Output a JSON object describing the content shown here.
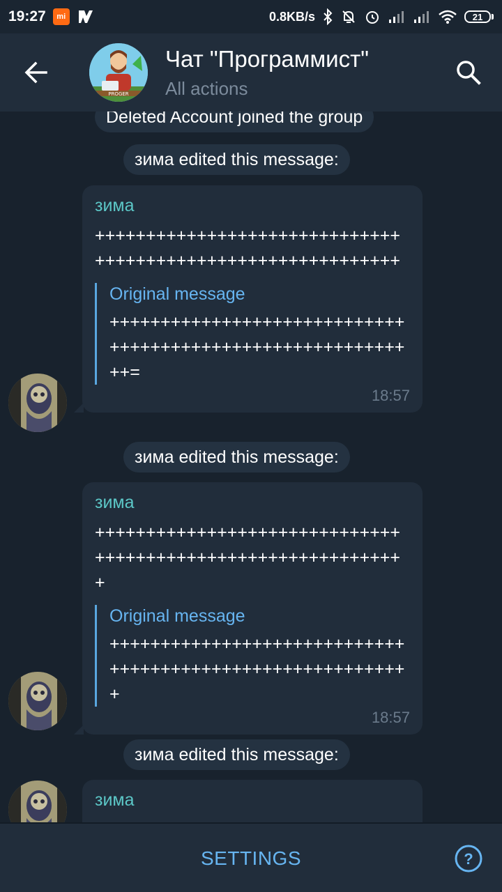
{
  "status_bar": {
    "time": "19:27",
    "mi_badge": "mi",
    "network_speed": "0.8KB/s",
    "battery_level": "21",
    "icons": [
      "mi-app-icon",
      "notification-icon",
      "bluetooth-icon",
      "silent-icon",
      "alarm-icon",
      "signal-icon",
      "signal-icon-2",
      "wifi-icon",
      "battery-icon"
    ]
  },
  "header": {
    "title": "Чат \"Программист\"",
    "subtitle": "All actions",
    "avatar_caption": "PROGER"
  },
  "events": [
    {
      "type": "service",
      "text": "Deleted Account joined the group"
    },
    {
      "type": "service",
      "text": "зима edited this message:"
    },
    {
      "type": "message",
      "sender": "зима",
      "text": "++++++++++++++++++++++++++++++++++++++++++++++++++++++++++++",
      "quote_title": "Original message",
      "quote_text": "++++++++++++++++++++++++++++++++++++++++++++++++++++++++++++=",
      "time": "18:57"
    },
    {
      "type": "service",
      "text": "зима edited this message:"
    },
    {
      "type": "message",
      "sender": "зима",
      "text": "+++++++++++++++++++++++++++++++++++++++++++++++++++++++++++++",
      "quote_title": "Original message",
      "quote_text": "+++++++++++++++++++++++++++++++++++++++++++++++++++++++++++",
      "time": "18:57"
    },
    {
      "type": "service",
      "text": "зима edited this message:"
    },
    {
      "type": "message_partial",
      "sender": "зима"
    }
  ],
  "bottom_bar": {
    "settings_label": "SETTINGS",
    "help_label": "?"
  },
  "colors": {
    "background": "#18222d",
    "header": "#212d3b",
    "bubble": "#212d3b",
    "sender_name": "#5cc7c7",
    "accent": "#67b5f1",
    "time": "#6b7b8c"
  }
}
